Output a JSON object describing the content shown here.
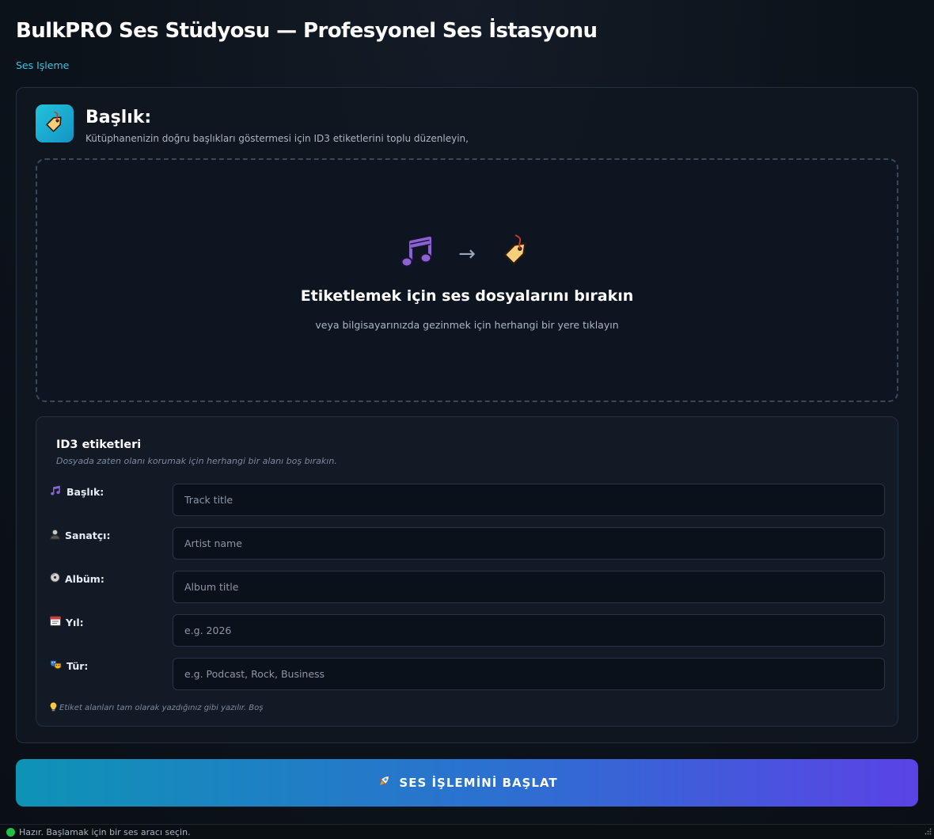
{
  "header": {
    "title": "BulkPRO Ses Stüdyosu — Profesyonel Ses İstasyonu",
    "breadcrumb": "Ses Işleme"
  },
  "tool": {
    "icon": "tag-icon",
    "title": "Başlık:",
    "description": "Kütüphanenizin doğru başlıkları göstermesi için ID3 etiketlerini toplu düzenleyin,"
  },
  "dropzone": {
    "icons": [
      "music-note-icon",
      "arrow-right-icon",
      "tag-icon"
    ],
    "title": "Etiketlemek için ses dosyalarını bırakın",
    "subtitle": "veya bilgisayarınızda gezinmek için herhangi bir yere tıklayın"
  },
  "id3": {
    "title": "ID3 etiketleri",
    "hint": "Dosyada zaten olanı korumak için herhangi bir alanı boş bırakın.",
    "fields": [
      {
        "icon": "music-note-icon",
        "label": "Başlık:",
        "placeholder": "Track title",
        "value": ""
      },
      {
        "icon": "singer-icon",
        "label": "Sanatçı:",
        "placeholder": "Artist name",
        "value": ""
      },
      {
        "icon": "disc-icon",
        "label": "Albüm:",
        "placeholder": "Album title",
        "value": ""
      },
      {
        "icon": "calendar-icon",
        "label": "Yıl:",
        "placeholder": "e.g. 2026",
        "value": ""
      },
      {
        "icon": "theater-masks-icon",
        "label": "Tür:",
        "placeholder": "e.g. Podcast, Rock, Business",
        "value": ""
      }
    ],
    "footer_icon": "lightbulb-icon",
    "footer": "Etiket alanları tam olarak yazdığınız gibi yazılır. Boş"
  },
  "action": {
    "icon": "rocket-icon",
    "label": "SES İŞLEMİNİ BAŞLAT"
  },
  "status": {
    "text": "Hazır. Başlamak için bir ses aracı seçin.",
    "color": "#21c146"
  },
  "colors": {
    "accent": "#32c5e0",
    "button_start": "#0e93b6",
    "button_end": "#5a43e6",
    "panel_border": "#223040"
  }
}
